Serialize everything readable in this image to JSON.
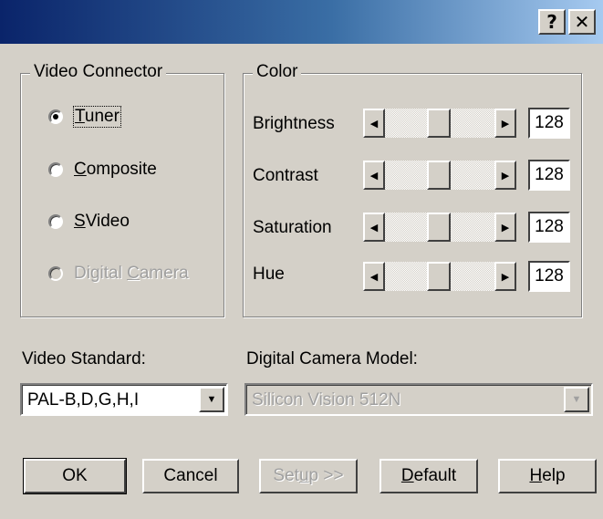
{
  "titlebar": {
    "help_glyph": "?",
    "close_glyph": "✕"
  },
  "video_connector": {
    "legend": "Video Connector",
    "options": [
      {
        "accel": "T",
        "rest": "uner",
        "checked": true,
        "enabled": true
      },
      {
        "accel": "C",
        "rest": "omposite",
        "checked": false,
        "enabled": true
      },
      {
        "accel": "S",
        "rest": "Video",
        "checked": false,
        "enabled": true
      },
      {
        "pre": "Digital ",
        "accel": "C",
        "rest": "amera",
        "checked": false,
        "enabled": false
      }
    ]
  },
  "color": {
    "legend": "Color",
    "sliders": [
      {
        "label": "Brightness",
        "value": "128"
      },
      {
        "label": "Contrast",
        "value": "128"
      },
      {
        "label": "Saturation",
        "value": "128"
      },
      {
        "label": "Hue",
        "value": "128"
      }
    ]
  },
  "video_standard": {
    "label": "Video Standard:",
    "value": "PAL-B,D,G,H,I"
  },
  "camera_model": {
    "label": "Digital Camera Model:",
    "value": "Silicon Vision 512N"
  },
  "buttons": {
    "ok": "OK",
    "cancel": "Cancel",
    "setup_pre": "Set",
    "setup_accel": "u",
    "setup_rest": "p >>",
    "default_accel": "D",
    "default_rest": "efault",
    "help_accel": "H",
    "help_rest": "elp"
  }
}
